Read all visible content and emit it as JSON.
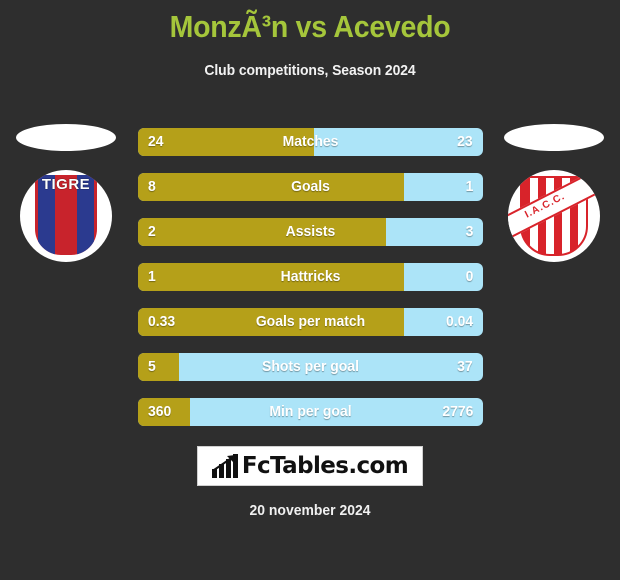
{
  "header": {
    "title": "MonzÃ³n vs Acevedo",
    "subtitle": "Club competitions, Season 2024"
  },
  "teams": {
    "home": {
      "badge_text": "TIGRE"
    },
    "away": {
      "badge_text": "I.A.C.C."
    }
  },
  "colors": {
    "background": "#2e2e2e",
    "title": "#a5c63b",
    "home_bar": "#b5a019",
    "away_bar": "#ace4f8",
    "text": "#ffffff"
  },
  "chart_data": {
    "type": "bar",
    "title": "MonzÃ³n vs Acevedo",
    "subtitle": "Club competitions, Season 2024",
    "orientation": "horizontal-diverging",
    "legend": [
      "MonzÃ³n",
      "Acevedo"
    ],
    "categories": [
      "Matches",
      "Goals",
      "Assists",
      "Hattricks",
      "Goals per match",
      "Shots per goal",
      "Min per goal"
    ],
    "series": [
      {
        "name": "MonzÃ³n",
        "values": [
          "24",
          "8",
          "2",
          "1",
          "0.33",
          "5",
          "360"
        ]
      },
      {
        "name": "Acevedo",
        "values": [
          "23",
          "1",
          "3",
          "0",
          "0.04",
          "37",
          "2776"
        ]
      }
    ],
    "home_fill_pct": [
      51,
      77,
      72,
      77,
      77,
      12,
      15
    ]
  },
  "rows": [
    {
      "label": "Matches",
      "home": "24",
      "away": "23",
      "pct": 51
    },
    {
      "label": "Goals",
      "home": "8",
      "away": "1",
      "pct": 77
    },
    {
      "label": "Assists",
      "home": "2",
      "away": "3",
      "pct": 72
    },
    {
      "label": "Hattricks",
      "home": "1",
      "away": "0",
      "pct": 77
    },
    {
      "label": "Goals per match",
      "home": "0.33",
      "away": "0.04",
      "pct": 77
    },
    {
      "label": "Shots per goal",
      "home": "5",
      "away": "37",
      "pct": 12
    },
    {
      "label": "Min per goal",
      "home": "360",
      "away": "2776",
      "pct": 15
    }
  ],
  "footer": {
    "brand": "FcTables.com",
    "date": "20 november 2024"
  }
}
